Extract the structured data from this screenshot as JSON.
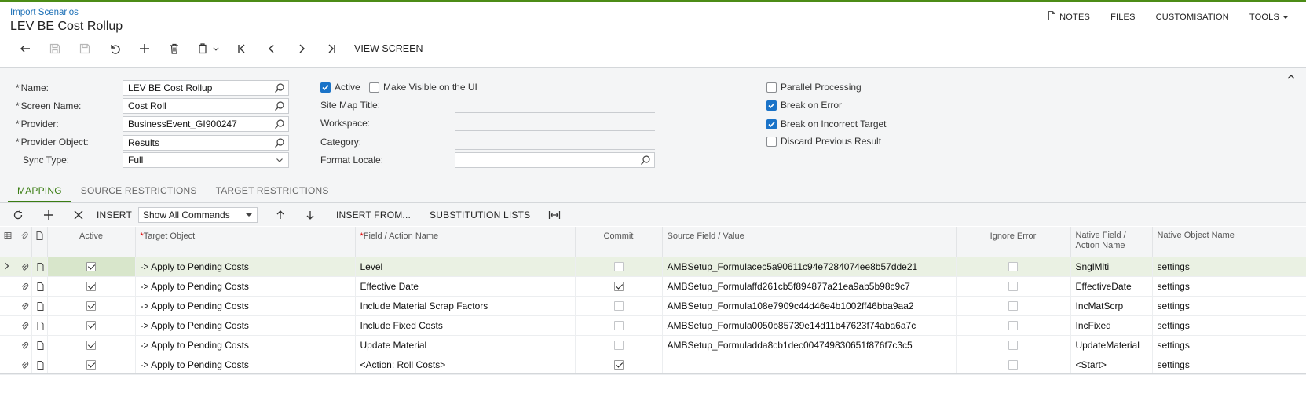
{
  "header": {
    "breadcrumb": "Import Scenarios",
    "title": "LEV BE Cost Rollup",
    "menu": [
      {
        "label": "NOTES",
        "icon": "document-icon"
      },
      {
        "label": "FILES"
      },
      {
        "label": "CUSTOMISATION"
      },
      {
        "label": "TOOLS",
        "icon": "caret-down-icon"
      }
    ]
  },
  "toolbar": {
    "view_screen_label": "VIEW SCREEN"
  },
  "form": {
    "name_label": "Name:",
    "name_value": "LEV BE Cost Rollup",
    "screen_name_label": "Screen Name:",
    "screen_name_value": "Cost Roll",
    "provider_label": "Provider:",
    "provider_value": "BusinessEvent_GI900247",
    "provider_object_label": "Provider Object:",
    "provider_object_value": "Results",
    "sync_type_label": "Sync Type:",
    "sync_type_value": "Full",
    "active_label": "Active",
    "active_checked": true,
    "make_visible_label": "Make Visible on the UI",
    "make_visible_checked": false,
    "site_map_title_label": "Site Map Title:",
    "workspace_label": "Workspace:",
    "category_label": "Category:",
    "format_locale_label": "Format Locale:",
    "parallel_label": "Parallel Processing",
    "parallel_checked": false,
    "break_error_label": "Break on Error",
    "break_error_checked": true,
    "break_target_label": "Break on Incorrect Target",
    "break_target_checked": true,
    "discard_label": "Discard Previous Result",
    "discard_checked": false
  },
  "tabs": [
    {
      "label": "MAPPING",
      "active": true
    },
    {
      "label": "SOURCE RESTRICTIONS",
      "active": false
    },
    {
      "label": "TARGET RESTRICTIONS",
      "active": false
    }
  ],
  "grid_toolbar": {
    "insert_label": "INSERT",
    "commands_value": "Show All Commands",
    "insert_from_label": "INSERT FROM...",
    "substitution_label": "SUBSTITUTION LISTS"
  },
  "grid": {
    "columns": {
      "active": "Active",
      "target_object": "Target Object",
      "field_action": "Field / Action Name",
      "commit": "Commit",
      "source_field": "Source Field / Value",
      "ignore_error": "Ignore Error",
      "native_field": "Native Field / Action Name",
      "native_object": "Native Object Name"
    },
    "rows": [
      {
        "active": true,
        "target": "-> Apply to Pending Costs",
        "field": "Level",
        "commit": false,
        "source": "AMBSetup_Formulacec5a90611c94e7284074ee8b57dde21",
        "ignore": false,
        "native_field": "SnglMlti",
        "native_object": "settings"
      },
      {
        "active": true,
        "target": "-> Apply to Pending Costs",
        "field": "Effective Date",
        "commit": true,
        "source": "AMBSetup_Formulaffd261cb5f894877a21ea9ab5b98c9c7",
        "ignore": false,
        "native_field": "EffectiveDate",
        "native_object": "settings"
      },
      {
        "active": true,
        "target": "-> Apply to Pending Costs",
        "field": "Include Material Scrap Factors",
        "commit": false,
        "source": "AMBSetup_Formula108e7909c44d46e4b1002ff46bba9aa2",
        "ignore": false,
        "native_field": "IncMatScrp",
        "native_object": "settings"
      },
      {
        "active": true,
        "target": "-> Apply to Pending Costs",
        "field": "Include Fixed Costs",
        "commit": false,
        "source": "AMBSetup_Formula0050b85739e14d11b47623f74aba6a7c",
        "ignore": false,
        "native_field": "IncFixed",
        "native_object": "settings"
      },
      {
        "active": true,
        "target": "-> Apply to Pending Costs",
        "field": "Update Material",
        "commit": false,
        "source": "AMBSetup_Formuladda8cb1dec004749830651f876f7c3c5",
        "ignore": false,
        "native_field": "UpdateMaterial",
        "native_object": "settings"
      },
      {
        "active": true,
        "target": "-> Apply to Pending Costs",
        "field": "<Action: Roll Costs>",
        "commit": true,
        "source": "",
        "ignore": false,
        "native_field": "<Start>",
        "native_object": "settings"
      }
    ]
  }
}
